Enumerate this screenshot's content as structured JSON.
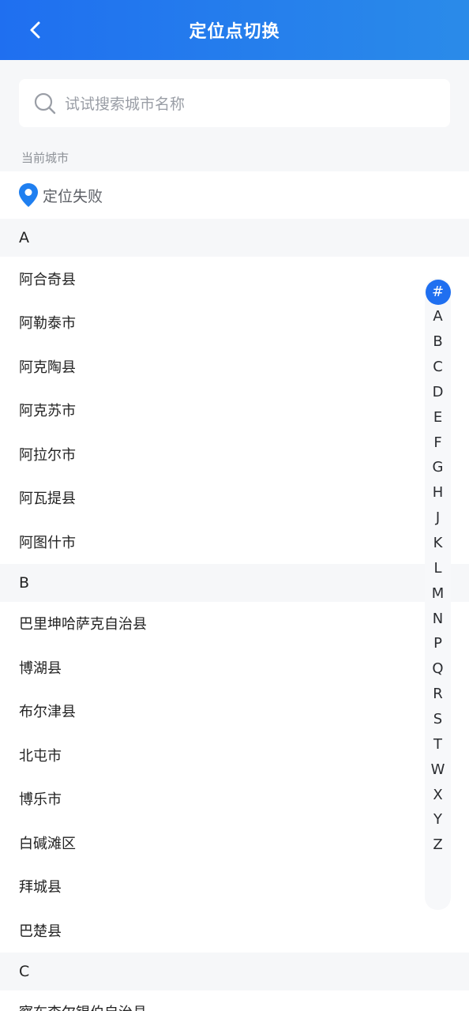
{
  "header": {
    "title": "定位点切换",
    "background_start": "#1f6ff0",
    "background_end": "#2a8be9",
    "back_icon": "chevron-left-icon"
  },
  "search": {
    "placeholder": "试试搜索城市名称",
    "icon": "search-icon"
  },
  "current_city": {
    "label": "当前城市",
    "status": "定位失败",
    "icon": "location-pin-icon",
    "icon_color": "#1f7ff0"
  },
  "sections": [
    {
      "letter": "A",
      "cities": [
        "阿合奇县",
        "阿勒泰市",
        "阿克陶县",
        "阿克苏市",
        "阿拉尔市",
        "阿瓦提县",
        "阿图什市"
      ]
    },
    {
      "letter": "B",
      "cities": [
        "巴里坤哈萨克自治县",
        "博湖县",
        "布尔津县",
        "北屯市",
        "博乐市",
        "白碱滩区",
        "拜城县",
        "巴楚县"
      ]
    },
    {
      "letter": "C",
      "cities": [
        "察布查尔锡伯自治县"
      ]
    }
  ],
  "index_bar": {
    "letters": [
      "#",
      "A",
      "B",
      "C",
      "D",
      "E",
      "F",
      "G",
      "H",
      "J",
      "K",
      "L",
      "M",
      "N",
      "P",
      "Q",
      "R",
      "S",
      "T",
      "W",
      "X",
      "Y",
      "Z"
    ],
    "active": "#",
    "active_color": "#1f6ff0"
  }
}
